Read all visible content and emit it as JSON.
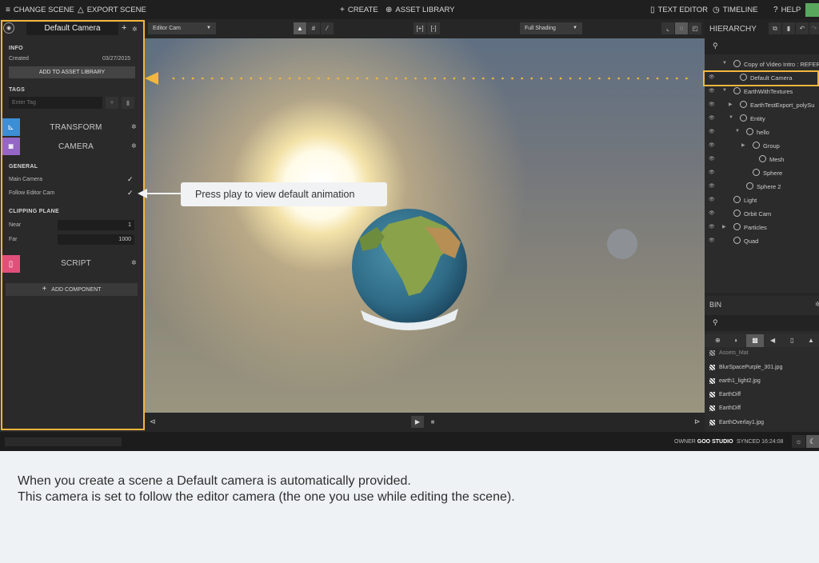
{
  "topbar": {
    "change_scene": "CHANGE SCENE",
    "export_scene": "EXPORT SCENE",
    "create": "CREATE",
    "asset_library": "ASSET LIBRARY",
    "text_editor": "TEXT EDITOR",
    "timeline": "TIMELINE",
    "help": "HELP"
  },
  "inspector": {
    "entity_name": "Default Camera",
    "info_header": "INFO",
    "created_label": "Created",
    "created_value": "03/27/2015",
    "add_to_library": "ADD TO ASSET LIBRARY",
    "tags_header": "TAGS",
    "tag_placeholder": "Enter Tag",
    "components": {
      "transform": "TRANSFORM",
      "camera": "CAMERA",
      "script": "SCRIPT"
    },
    "general_header": "GENERAL",
    "main_camera": "Main Camera",
    "follow_editor_cam": "Follow Editor Cam",
    "clipping_header": "CLIPPING PLANE",
    "near_label": "Near",
    "near_value": "1",
    "far_label": "Far",
    "far_value": "1000",
    "add_component": "ADD COMPONENT"
  },
  "viewport": {
    "camera_select": "Editor Cam",
    "shading_select": "Full Shading"
  },
  "hint": "Press play to view default animation",
  "hierarchy": {
    "title": "HIERARCHY",
    "items": [
      {
        "label": "Copy of Video Intro : REFERE"
      },
      {
        "label": "Default Camera"
      },
      {
        "label": "EarthWithTextures"
      },
      {
        "label": "EarthTestExport_polySu"
      },
      {
        "label": "Entity"
      },
      {
        "label": "hello"
      },
      {
        "label": "Group"
      },
      {
        "label": "Mesh"
      },
      {
        "label": "Sphere"
      },
      {
        "label": "Sphere 2"
      },
      {
        "label": "Light"
      },
      {
        "label": "Orbit Cam"
      },
      {
        "label": "Particles"
      },
      {
        "label": "Quad"
      }
    ]
  },
  "bin": {
    "title": "BIN",
    "items": [
      {
        "label": "Assets_Mat"
      },
      {
        "label": "BlurSpacePurple_301.jpg"
      },
      {
        "label": "earth1_light2.jpg"
      },
      {
        "label": "EarthDiff"
      },
      {
        "label": "EarthDiff"
      },
      {
        "label": "EarthOverlay1.jpg"
      }
    ]
  },
  "status": {
    "owner_label": "OWNER",
    "owner_value": "GOO STUDIO",
    "synced": "SYNCED 16:24:08"
  },
  "caption": {
    "line1": "When you create a scene a Default camera is automatically provided.",
    "line2": "This camera is set to follow the editor camera (the one you use while editing the scene)."
  },
  "colors": {
    "highlight": "#f4b63d",
    "transform_icon": "#3c8fd6",
    "camera_icon": "#9466c6",
    "script_icon": "#e0507b"
  },
  "icons": [
    "menu-icon",
    "export-icon",
    "plus-icon",
    "sitemap-icon",
    "document-icon",
    "timeline-icon",
    "help-icon",
    "camera-icon",
    "gear-icon",
    "play-icon",
    "stop-icon",
    "eye-icon",
    "search-icon"
  ]
}
